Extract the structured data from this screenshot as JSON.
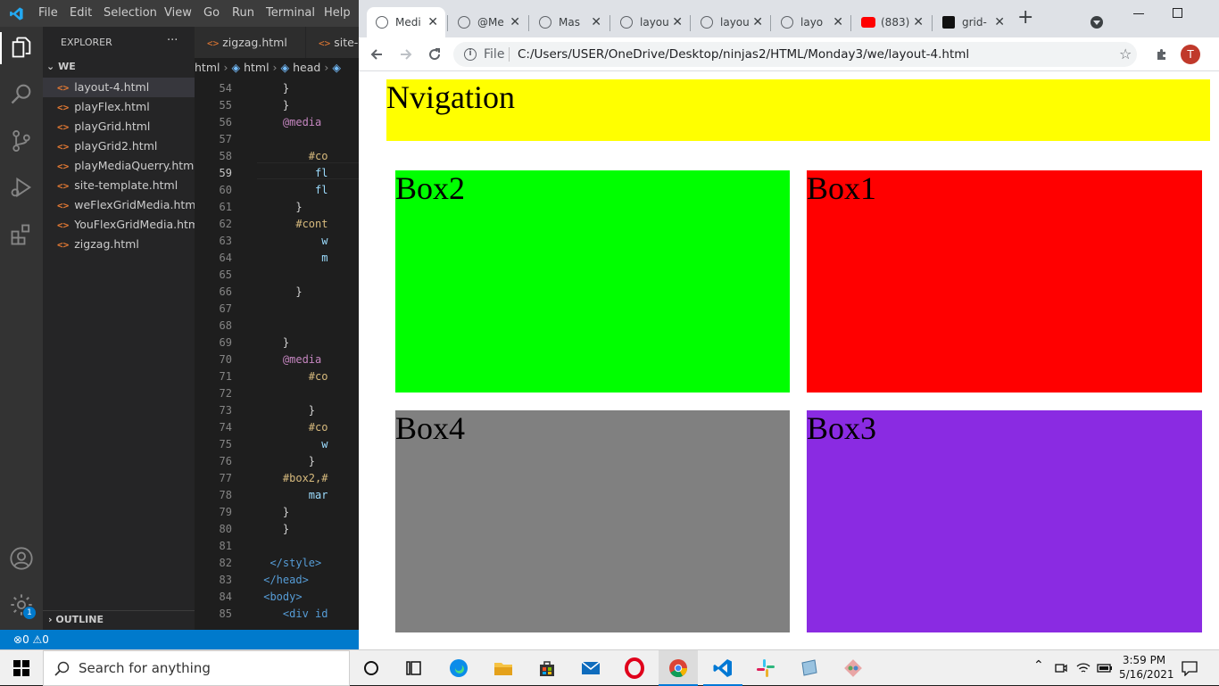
{
  "vscode": {
    "menu": [
      "File",
      "Edit",
      "Selection",
      "View",
      "Go",
      "Run",
      "Terminal",
      "Help"
    ],
    "explorer_title": "EXPLORER",
    "explorer_more": "···",
    "folder": "WE",
    "files": [
      "layout-4.html",
      "playFlex.html",
      "playGrid.html",
      "playGrid2.html",
      "playMediaQuerry.html",
      "site-template.html",
      "weFlexGridMedia.html",
      "YouFlexGridMedia.html",
      "zigzag.html"
    ],
    "outline": "OUTLINE",
    "tabs": [
      "zigzag.html",
      "site-"
    ],
    "breadcrumb": [
      "html",
      "html",
      "head"
    ],
    "code_lines": [
      {
        "n": "54",
        "t": "    }"
      },
      {
        "n": "55",
        "t": "    }"
      },
      {
        "n": "56",
        "t": "    @media"
      },
      {
        "n": "57",
        "t": ""
      },
      {
        "n": "58",
        "t": "        #co"
      },
      {
        "n": "59",
        "t": "         fl"
      },
      {
        "n": "60",
        "t": "         fl"
      },
      {
        "n": "61",
        "t": "      }"
      },
      {
        "n": "62",
        "t": "      #cont"
      },
      {
        "n": "63",
        "t": "          w"
      },
      {
        "n": "64",
        "t": "          m"
      },
      {
        "n": "65",
        "t": ""
      },
      {
        "n": "66",
        "t": "      }"
      },
      {
        "n": "67",
        "t": ""
      },
      {
        "n": "68",
        "t": ""
      },
      {
        "n": "69",
        "t": "    }"
      },
      {
        "n": "70",
        "t": "    @media"
      },
      {
        "n": "71",
        "t": "        #co"
      },
      {
        "n": "72",
        "t": ""
      },
      {
        "n": "73",
        "t": "        }"
      },
      {
        "n": "74",
        "t": "        #co"
      },
      {
        "n": "75",
        "t": "          w"
      },
      {
        "n": "76",
        "t": "        }"
      },
      {
        "n": "77",
        "t": "    #box2,#"
      },
      {
        "n": "78",
        "t": "        mar"
      },
      {
        "n": "79",
        "t": "    }"
      },
      {
        "n": "80",
        "t": "    }"
      },
      {
        "n": "81",
        "t": ""
      },
      {
        "n": "82",
        "t": "  </style>"
      },
      {
        "n": "83",
        "t": " </head>"
      },
      {
        "n": "84",
        "t": " <body>"
      },
      {
        "n": "85",
        "t": "    <div id"
      }
    ],
    "status_errors": "0",
    "status_warnings": "0",
    "accounts_badge": "1"
  },
  "chrome": {
    "tabs": [
      "Medi",
      "@Me",
      "Mas",
      "layou",
      "layou",
      "layo",
      "(883)",
      "grid-"
    ],
    "url_label": "File",
    "url": "C:/Users/USER/OneDrive/Desktop/ninjas2/HTML/Monday3/we/layout-4.html",
    "profile_initial": "T"
  },
  "page": {
    "nav_text": "Nvigation",
    "boxes": [
      {
        "label": "Box2",
        "color": "#00ff00"
      },
      {
        "label": "Box1",
        "color": "#ff0000"
      },
      {
        "label": "Box4",
        "color": "#808080"
      },
      {
        "label": "Box3",
        "color": "#8a2be2"
      }
    ],
    "nav_color": "#ffff00"
  },
  "taskbar": {
    "search_placeholder": "Search for anything",
    "time": "3:59 PM",
    "date": "5/16/2021"
  }
}
